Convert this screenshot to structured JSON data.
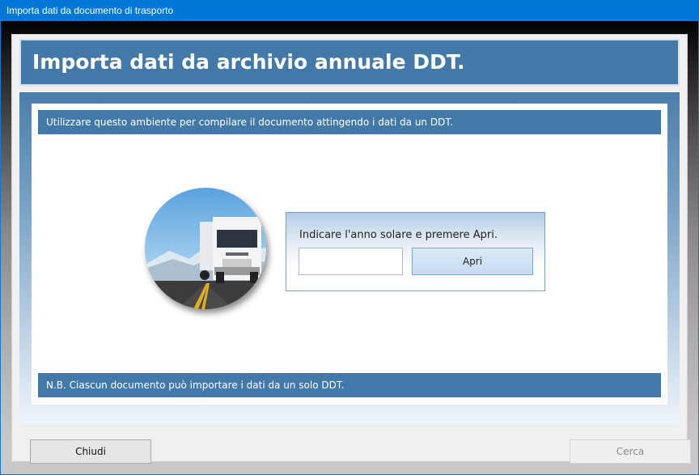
{
  "window": {
    "title": "Importa dati da documento di trasporto"
  },
  "header": {
    "title": "Importa dati da archivio annuale DDT."
  },
  "info": {
    "top": "Utilizzare questo ambiente per compilare il documento attingendo i dati da un DDT.",
    "bottom": "N.B. Ciascun documento può importare i dati da un solo DDT."
  },
  "prompt": {
    "label": "Indicare l'anno solare e premere Apri.",
    "year_value": "",
    "open_label": "Apri"
  },
  "footer": {
    "close_label": "Chiudi",
    "search_label": "Cerca"
  },
  "colors": {
    "accent": "#4279a8",
    "titlebar": "#0078d7"
  }
}
